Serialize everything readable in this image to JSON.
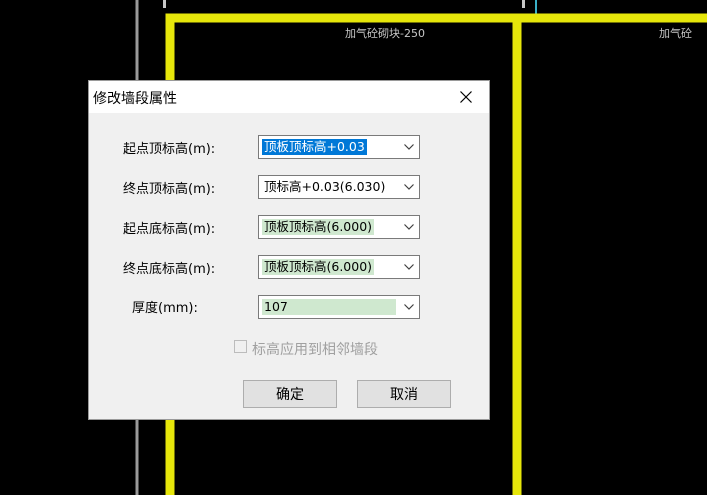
{
  "canvas": {
    "wall_label_left": "加气砼砌块-250",
    "wall_label_right": "加气砼",
    "wall_color": "#e6e60a"
  },
  "dialog": {
    "title": "修改墙段属性",
    "fields": [
      {
        "label": "起点顶标高(m):",
        "value": "顶板顶标高+0.03"
      },
      {
        "label": "终点顶标高(m):",
        "value": "顶标高+0.03(6.030)"
      },
      {
        "label": "起点底标高(m):",
        "value": "顶板顶标高(6.000)"
      },
      {
        "label": "终点底标高(m):",
        "value": "顶板顶标高(6.000)"
      },
      {
        "label": "厚度(mm):",
        "value": "107"
      }
    ],
    "checkbox_label": "标高应用到相邻墙段",
    "checkbox_checked": false,
    "checkbox_enabled": false,
    "ok_label": "确定",
    "cancel_label": "取消"
  }
}
